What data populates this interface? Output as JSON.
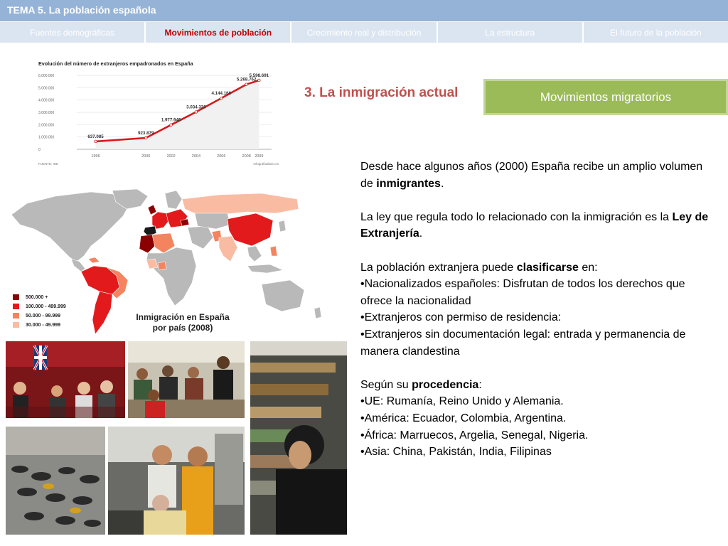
{
  "header": {
    "title": "TEMA 5. La población española"
  },
  "nav": {
    "tabs": [
      {
        "label": "Fuentes demográficas",
        "active": false
      },
      {
        "label": "Movimientos de población",
        "active": true
      },
      {
        "label": "Crecimiento real y distribución",
        "active": false
      },
      {
        "label": "La estructura",
        "active": false
      },
      {
        "label": "El futuro de la población",
        "active": false
      }
    ]
  },
  "section": {
    "title": "3. La inmigración actual",
    "button_label": "Movimientos migratorios"
  },
  "content": {
    "p1_a": "Desde hace algunos años (2000) España recibe un amplio volumen de ",
    "p1_b": "inmigrantes",
    "p1_c": ".",
    "p2_a": "La ley que regula todo lo relacionado con la inmigración es la ",
    "p2_b": "Ley de Extranjería",
    "p2_c": ".",
    "p3_a": "La población extranjera puede ",
    "p3_b": "clasificarse",
    "p3_c": " en:",
    "bullets1": [
      "•Nacionalizados españoles: Disfrutan de todos los derechos que ofrece la nacionalidad",
      "•Extranjeros con permiso de residencia:",
      "•Extranjeros sin documentación legal: entrada y permanencia de manera clandestina"
    ],
    "p4_a": "Según su ",
    "p4_b": "procedencia",
    "p4_c": ":",
    "bullets2": [
      "•UE: Rumanía, Reino Unido y Alemania.",
      "•América: Ecuador, Colombia, Argentina.",
      "•África: Marruecos,  Argelia, Senegal, Nigeria.",
      "•Asia: China, Pakistán, India, Filipinas"
    ]
  },
  "map": {
    "caption_line1": "Inmigración en España",
    "caption_line2": "por país (2008)",
    "legend": [
      {
        "label": "500.000  +",
        "color": "#8b0000"
      },
      {
        "label": "100.000 - 499.999",
        "color": "#e31a1c"
      },
      {
        "label": "50.000 -  99.999",
        "color": "#f4845f"
      },
      {
        "label": "30.000 -  49.999",
        "color": "#f9bca3"
      }
    ],
    "base_color": "#b9b9b9"
  },
  "chart_data": {
    "type": "line",
    "title": "Evolución del número de extranjeros empadronados en España",
    "source_left": "FUENTE: INE",
    "source_right": "infografiadiario.es",
    "x": [
      1996,
      2000,
      2002,
      2004,
      2006,
      2008,
      2009
    ],
    "y": [
      637085,
      923879,
      1977946,
      3034326,
      4144166,
      5268762,
      5598691
    ],
    "data_labels": [
      "637.085",
      "923.879",
      "1.977.946",
      "3.034.326",
      "4.144.166",
      "5.268.762",
      "5.598.691"
    ],
    "x_ticks": [
      "1996",
      "2000",
      "2002",
      "2004",
      "2006",
      "2008",
      "2009"
    ],
    "y_ticks": [
      0,
      1000000,
      2000000,
      3000000,
      4000000,
      5000000,
      6000000
    ],
    "y_tick_labels": [
      "0",
      "1.000.000",
      "2.000.000",
      "3.000.000",
      "4.000.000",
      "5.000.000",
      "6.000.000"
    ],
    "ylim": [
      0,
      6000000
    ],
    "line_color": "#d7191c",
    "grid": true
  }
}
